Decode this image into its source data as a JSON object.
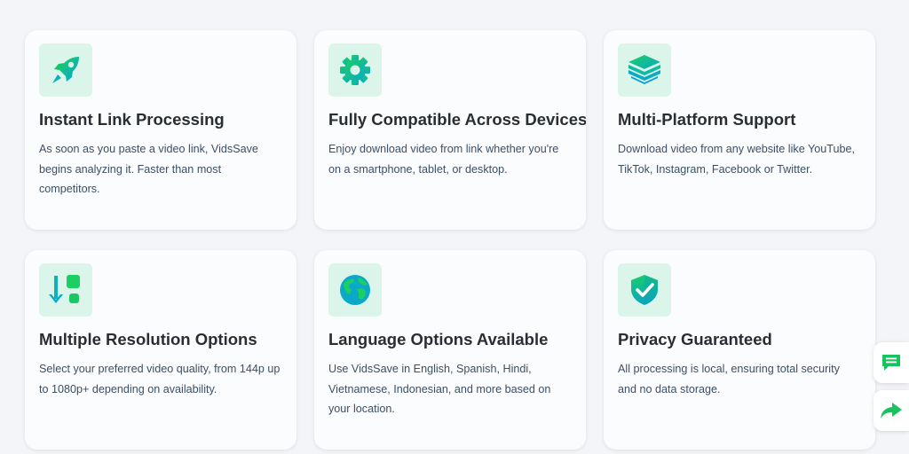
{
  "features": [
    {
      "icon": "rocket-icon",
      "title": "Instant Link Processing",
      "description": "As soon as you paste a video link, VidsSave begins analyzing it. Faster than most competitors."
    },
    {
      "icon": "gear-icon",
      "title": "Fully Compatible Across Devices",
      "description": "Enjoy download video from link whether you're on a smartphone, tablet, or desktop."
    },
    {
      "icon": "layers-icon",
      "title": "Multi-Platform Support",
      "description": "Download video from any website like YouTube, TikTok, Instagram, Facebook or Twitter."
    },
    {
      "icon": "sort-download-icon",
      "title": "Multiple Resolution Options",
      "description": "Select your preferred video quality, from 144p up to 1080p+ depending on availability."
    },
    {
      "icon": "globe-icon",
      "title": "Language Options Available",
      "description": "Use VidsSave in English, Spanish, Hindi, Vietnamese, Indonesian, and more based on your location."
    },
    {
      "icon": "shield-check-icon",
      "title": "Privacy Guaranteed",
      "description": "All processing is local, ensuring total security and no data storage."
    }
  ],
  "floating_buttons": [
    {
      "icon": "feedback-chat-icon"
    },
    {
      "icon": "share-arrow-icon"
    }
  ],
  "colors": {
    "accent_green": "#16c46a",
    "accent_teal": "#0fb5b2",
    "icon_background": "#dcf5ea",
    "card_background": "#fbfcfd",
    "page_background": "#f4f5f8"
  }
}
